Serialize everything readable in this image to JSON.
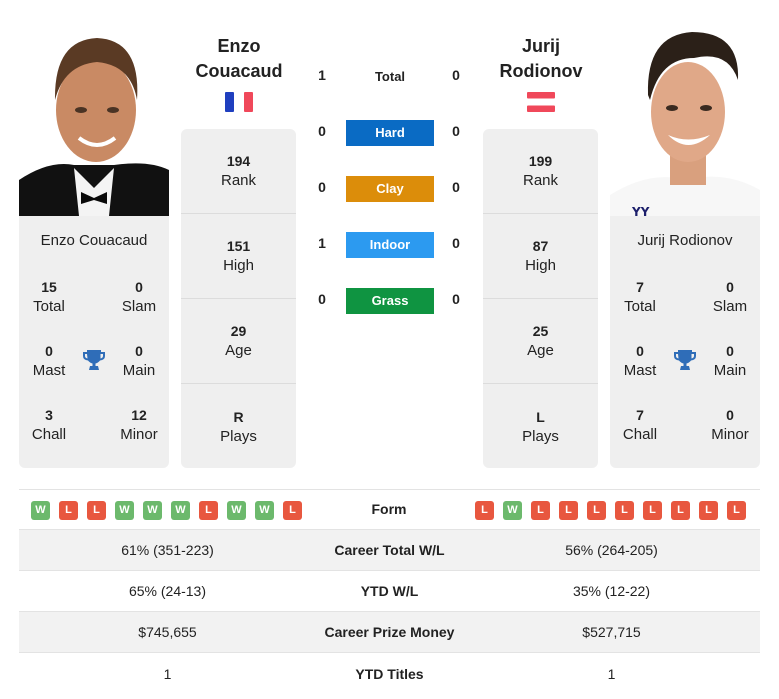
{
  "players": {
    "left": {
      "name_line1": "Enzo",
      "name_line2": "Couacaud",
      "full_name": "Enzo Couacaud",
      "flag": "france-flag",
      "flag_colors": [
        "#1f3fbf",
        "#ffffff",
        "#f0485a"
      ],
      "stats": [
        {
          "value": "194",
          "label": "Rank"
        },
        {
          "value": "151",
          "label": "High"
        },
        {
          "value": "29",
          "label": "Age"
        },
        {
          "value": "R",
          "label": "Plays"
        }
      ],
      "titles": {
        "total": {
          "value": "15",
          "label": "Total"
        },
        "slam": {
          "value": "0",
          "label": "Slam"
        },
        "mast": {
          "value": "0",
          "label": "Mast"
        },
        "main": {
          "value": "0",
          "label": "Main"
        },
        "chall": {
          "value": "3",
          "label": "Chall"
        },
        "minor": {
          "value": "12",
          "label": "Minor"
        }
      },
      "form": [
        "W",
        "L",
        "L",
        "W",
        "W",
        "W",
        "L",
        "W",
        "W",
        "L"
      ]
    },
    "right": {
      "name_line1": "Jurij",
      "name_line2": "Rodionov",
      "full_name": "Jurij Rodionov",
      "flag": "austria-flag",
      "flag_colors": [
        "#f0485a",
        "#ffffff",
        "#f0485a"
      ],
      "stats": [
        {
          "value": "199",
          "label": "Rank"
        },
        {
          "value": "87",
          "label": "High"
        },
        {
          "value": "25",
          "label": "Age"
        },
        {
          "value": "L",
          "label": "Plays"
        }
      ],
      "titles": {
        "total": {
          "value": "7",
          "label": "Total"
        },
        "slam": {
          "value": "0",
          "label": "Slam"
        },
        "mast": {
          "value": "0",
          "label": "Mast"
        },
        "main": {
          "value": "0",
          "label": "Main"
        },
        "chall": {
          "value": "7",
          "label": "Chall"
        },
        "minor": {
          "value": "0",
          "label": "Minor"
        }
      },
      "form": [
        "L",
        "W",
        "L",
        "L",
        "L",
        "L",
        "L",
        "L",
        "L",
        "L"
      ]
    }
  },
  "h2h": [
    {
      "label": "Total",
      "left": "1",
      "right": "0",
      "color": null
    },
    {
      "label": "Hard",
      "left": "0",
      "right": "0",
      "color": "#0a6bc4"
    },
    {
      "label": "Clay",
      "left": "0",
      "right": "0",
      "color": "#dc8d0a"
    },
    {
      "label": "Indoor",
      "left": "1",
      "right": "0",
      "color": "#2c9af0"
    },
    {
      "label": "Grass",
      "left": "0",
      "right": "0",
      "color": "#0f9441"
    }
  ],
  "form_label": "Form",
  "comparison": [
    {
      "label": "Career Total W/L",
      "left": "61% (351-223)",
      "right": "56% (264-205)"
    },
    {
      "label": "YTD W/L",
      "left": "65% (24-13)",
      "right": "35% (12-22)"
    },
    {
      "label": "Career Prize Money",
      "left": "$745,655",
      "right": "$527,715"
    },
    {
      "label": "YTD Titles",
      "left": "1",
      "right": "1"
    }
  ],
  "colors": {
    "win": "#6cb96c",
    "loss": "#e8573f",
    "trophy": "#2f6db8",
    "card_bg": "#efefef"
  }
}
